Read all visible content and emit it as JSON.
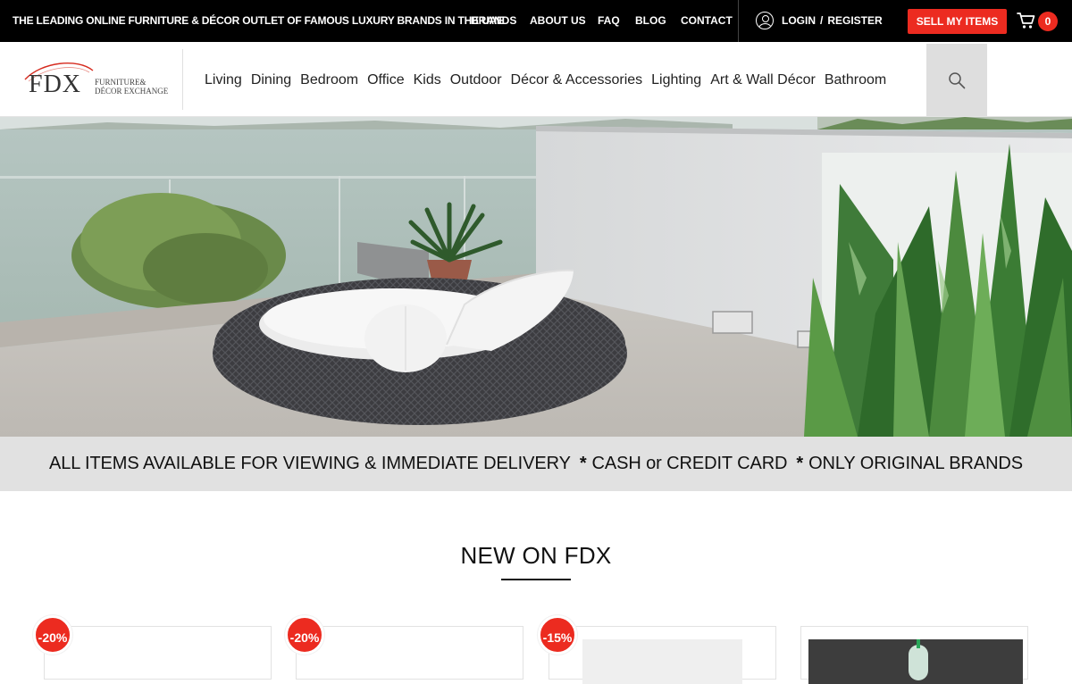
{
  "topbar": {
    "tagline": "THE LEADING ONLINE FURNITURE & DÉCOR OUTLET OF FAMOUS LUXURY BRANDS IN THE UAE",
    "links": [
      "BRANDS",
      "ABOUT US",
      "FAQ",
      "BLOG",
      "CONTACT"
    ],
    "login": "LOGIN",
    "separator": "/",
    "register": "REGISTER",
    "sell_button": "SELL MY ITEMS",
    "cart_count": "0"
  },
  "logo": {
    "mark": "FDX",
    "line1": "FURNITURE&",
    "line2": "DÉCOR EXCHANGE"
  },
  "nav": {
    "items": [
      "Living",
      "Dining",
      "Bedroom",
      "Office",
      "Kids",
      "Outdoor",
      "Décor & Accessories",
      "Lighting",
      "Art & Wall Décor",
      "Bathroom"
    ]
  },
  "strip": {
    "part1": "ALL ITEMS AVAILABLE FOR VIEWING & IMMEDIATE DELIVERY",
    "part2": "CASH or CREDIT CARD",
    "part3": "ONLY ORIGINAL BRANDS",
    "star": "*"
  },
  "section": {
    "title": "NEW ON FDX"
  },
  "products": [
    {
      "badge": "-20%"
    },
    {
      "badge": "-20%"
    },
    {
      "badge": "-15%"
    },
    {
      "badge": ""
    }
  ],
  "colors": {
    "accent": "#ec2b20",
    "topbar_bg": "#000000",
    "strip_bg": "#e1e1e1",
    "search_bg": "#dedede",
    "whatsapp": "#25d366"
  },
  "icons": [
    "user-icon",
    "cart-icon",
    "search-icon",
    "whatsapp-icon"
  ]
}
